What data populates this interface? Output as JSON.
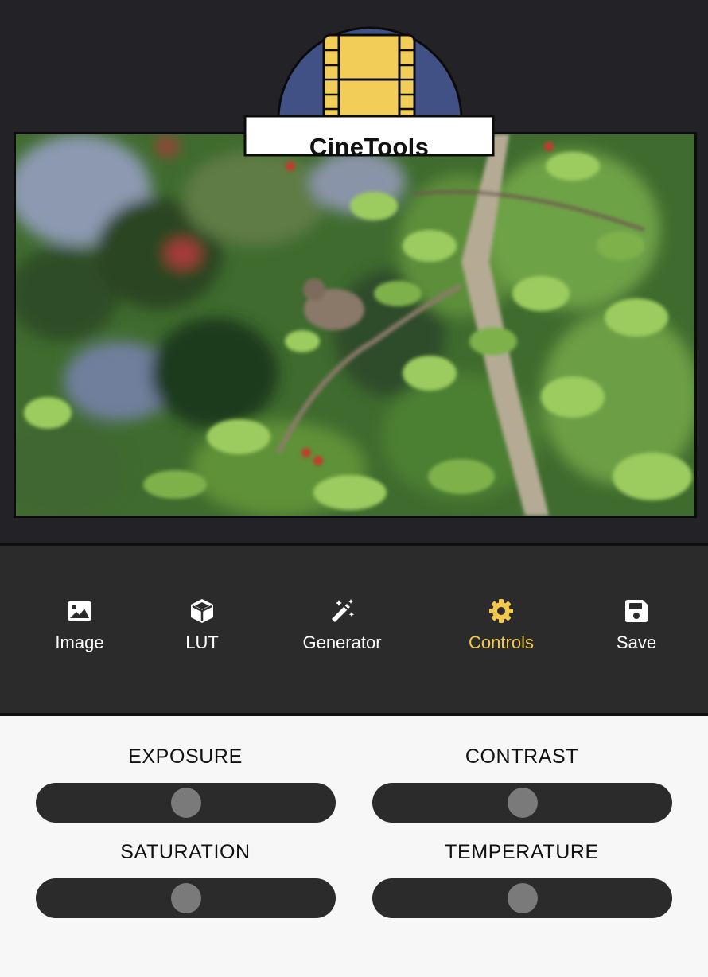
{
  "app": {
    "name": "CineTools"
  },
  "toolbar": {
    "items": [
      {
        "label": "Image",
        "icon": "image-icon",
        "active": false
      },
      {
        "label": "LUT",
        "icon": "cube-icon",
        "active": false
      },
      {
        "label": "Generator",
        "icon": "magic-wand-icon",
        "active": false
      },
      {
        "label": "Controls",
        "icon": "gear-icon",
        "active": true
      },
      {
        "label": "Save",
        "icon": "floppy-disk-icon",
        "active": false
      }
    ],
    "active_color": "#f2c94c"
  },
  "controls": {
    "exposure": {
      "label": "EXPOSURE",
      "value": 0.5
    },
    "contrast": {
      "label": "CONTRAST",
      "value": 0.5
    },
    "saturation": {
      "label": "SATURATION",
      "value": 0.5
    },
    "temperature": {
      "label": "TEMPERATURE",
      "value": 0.5
    }
  }
}
